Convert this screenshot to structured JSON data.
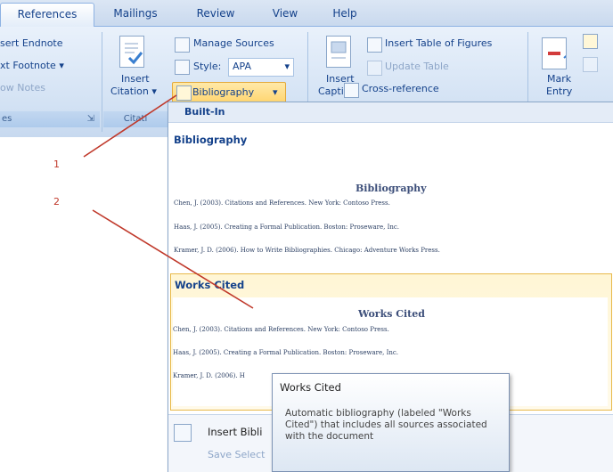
{
  "tabs": [
    "References",
    "Mailings",
    "Review",
    "View",
    "Help"
  ],
  "footnotes": {
    "insert_endnote": "sert Endnote",
    "next_footnote": "xt Footnote",
    "show_notes": "ow Notes",
    "group_label": "es"
  },
  "citations": {
    "insert_citation_line1": "Insert",
    "insert_citation_line2": "Citation",
    "manage_sources": "Manage Sources",
    "style_label": "Style:",
    "style_value": "APA",
    "bibliography": "Bibliography",
    "group_label": "Citati"
  },
  "captions": {
    "insert_caption_line1": "Insert",
    "insert_caption_line2": "Caption",
    "insert_table_of_figures": "Insert Table of Figures",
    "update_table": "Update Table",
    "cross_reference": "Cross-reference"
  },
  "index": {
    "mark_entry_line1": "Mark",
    "mark_entry_line2": "Entry"
  },
  "dropdown": {
    "builtin_header": "Built-In",
    "bibliography": {
      "heading": "Bibliography",
      "preview_title": "Bibliography",
      "entries": [
        "Chen, J. (2003). Citations and References. New York: Contoso Press.",
        "Haas, J. (2005). Creating a Formal Publication. Boston: Proseware, Inc.",
        "Kramer, J. D. (2006). How to Write Bibliographies. Chicago: Adventure Works Press."
      ]
    },
    "works_cited": {
      "heading": "Works Cited",
      "preview_title": "Works Cited",
      "entries": [
        "Chen, J. (2003). Citations and References. New York: Contoso Press.",
        "Haas, J. (2005). Creating a Formal Publication. Boston: Proseware, Inc.",
        "Kramer, J. D. (2006). H"
      ]
    },
    "insert_bibliography": "Insert Bibli",
    "save_selection": "Save Select"
  },
  "tooltip": {
    "title": "Works Cited",
    "body": "Automatic bibliography (labeled \"Works Cited\") that includes all sources associated with the document"
  },
  "annotations": {
    "step1": "1",
    "step2": "2"
  },
  "colors": {
    "ribbon_text": "#15428b",
    "highlight_border": "#e8b94a",
    "highlight_fill": "#fff4c8",
    "arrow": "#c0392b"
  }
}
